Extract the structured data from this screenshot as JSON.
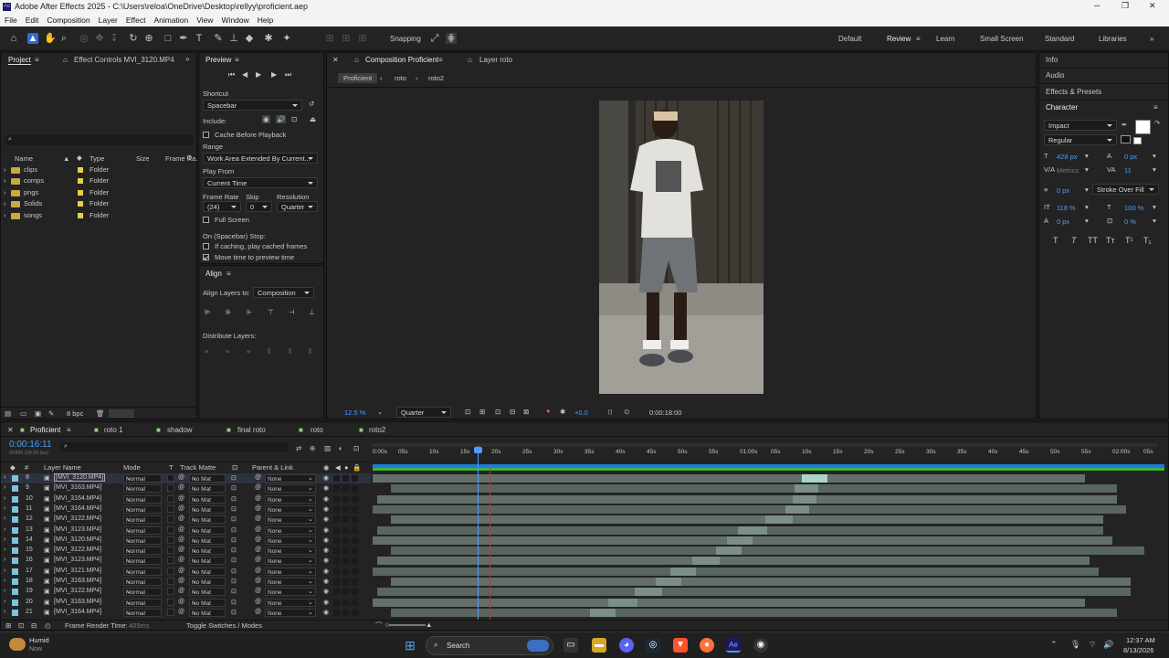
{
  "title": "Adobe After Effects 2025 - C:\\Users\\reloa\\OneDrive\\Desktop\\rellyy\\proficient.aep",
  "menu": [
    "File",
    "Edit",
    "Composition",
    "Layer",
    "Effect",
    "Animation",
    "View",
    "Window",
    "Help"
  ],
  "toolbar": {
    "snapping": "Snapping",
    "workspaces": [
      "Default",
      "Review",
      "Learn",
      "Small Screen",
      "Standard",
      "Libraries"
    ]
  },
  "project": {
    "tab": "Project",
    "effect_tab": "Effect Controls MVI_3120.MP4",
    "search_placeholder": "",
    "cols": [
      "Name",
      "Type",
      "Size",
      "Frame Ra..."
    ],
    "items": [
      {
        "name": "clips",
        "type": "Folder"
      },
      {
        "name": "comps",
        "type": "Folder"
      },
      {
        "name": "pngs",
        "type": "Folder"
      },
      {
        "name": "Solids",
        "type": "Folder"
      },
      {
        "name": "songs",
        "type": "Folder"
      }
    ],
    "bpc": "8 bpc"
  },
  "preview": {
    "tab": "Preview",
    "shortcut_label": "Shortcut",
    "shortcut": "Spacebar",
    "include": "Include:",
    "cache": "Cache Before Playback",
    "range_label": "Range",
    "range": "Work Area Extended By Current...",
    "playfrom_label": "Play From",
    "playfrom": "Current Time",
    "fr_label": "Frame Rate",
    "skip_label": "Skip",
    "res_label": "Resolution",
    "fr": "(24)",
    "skip": "0",
    "res": "Quarter",
    "fullscreen": "Full Screen",
    "stop_label": "On (Spacebar) Stop:",
    "stop1": "If caching, play cached frames",
    "stop2": "Move time to preview time"
  },
  "align": {
    "tab": "Align",
    "to_label": "Align Layers to:",
    "to": "Composition",
    "distribute": "Distribute Layers:"
  },
  "comp": {
    "tab": "Composition Proficient",
    "layer_tab": "Layer roto",
    "crumbs": [
      "Proficient",
      "roto",
      "roto2"
    ],
    "zoom": "12.5 %",
    "res": "Quarter",
    "exposure": "+0.0",
    "time": "0:00:18:00"
  },
  "right": {
    "info": "Info",
    "audio": "Audio",
    "effects": "Effects & Presets",
    "character": "Character",
    "font": "Impact",
    "style": "Regular",
    "size": "428 px",
    "leading": "0 px",
    "kerning": "Metrics",
    "tracking": "11",
    "stroke_w": "0 px",
    "stroke_type": "Stroke Over Fill",
    "vscale": "118 %",
    "hscale": "100 %",
    "baseline": "0 px",
    "tsume": "0 %"
  },
  "timeline": {
    "tabs": [
      "Proficient",
      "roto 1",
      "shadow",
      "final roto",
      "roto",
      "roto2"
    ],
    "timecode": "0:00:16:11",
    "frames": "00395 (24.00 fps)",
    "headers": {
      "num": "#",
      "name": "Layer Name",
      "mode": "Mode",
      "t": "T",
      "matte": "Track Matte",
      "parent": "Parent & Link"
    },
    "ruler": [
      "0:00s",
      "05s",
      "10s",
      "15s",
      "20s",
      "25s",
      "30s",
      "35s",
      "40s",
      "45s",
      "50s",
      "55s",
      "01:00s",
      "05s",
      "10s",
      "15s",
      "20s",
      "25s",
      "30s",
      "35s",
      "40s",
      "45s",
      "50s",
      "55s",
      "02:00s",
      "05s"
    ],
    "layers": [
      {
        "n": "8",
        "name": "[MVI_3120.MP4]",
        "mode": "Normal",
        "matte": "No Mat",
        "parent": "None"
      },
      {
        "n": "9",
        "name": "[MVI_3163.MP4]",
        "mode": "Normal",
        "matte": "No Mat",
        "parent": "None"
      },
      {
        "n": "10",
        "name": "[MVI_3164.MP4]",
        "mode": "Normal",
        "matte": "No Mat",
        "parent": "None"
      },
      {
        "n": "11",
        "name": "[MVI_3164.MP4]",
        "mode": "Normal",
        "matte": "No Mat",
        "parent": "None"
      },
      {
        "n": "12",
        "name": "[MVI_3122.MP4]",
        "mode": "Normal",
        "matte": "No Mat",
        "parent": "None"
      },
      {
        "n": "13",
        "name": "[MVI_3123.MP4]",
        "mode": "Normal",
        "matte": "No Mat",
        "parent": "None"
      },
      {
        "n": "14",
        "name": "[MVI_3120.MP4]",
        "mode": "Normal",
        "matte": "No Mat",
        "parent": "None"
      },
      {
        "n": "15",
        "name": "[MVI_3122.MP4]",
        "mode": "Normal",
        "matte": "No Mat",
        "parent": "None"
      },
      {
        "n": "16",
        "name": "[MVI_3123.MP4]",
        "mode": "Normal",
        "matte": "No Mat",
        "parent": "None"
      },
      {
        "n": "17",
        "name": "[MVI_3121.MP4]",
        "mode": "Normal",
        "matte": "No Mat",
        "parent": "None"
      },
      {
        "n": "18",
        "name": "[MVI_3163.MP4]",
        "mode": "Normal",
        "matte": "No Mat",
        "parent": "None"
      },
      {
        "n": "19",
        "name": "[MVI_3122.MP4]",
        "mode": "Normal",
        "matte": "No Mat",
        "parent": "None"
      },
      {
        "n": "20",
        "name": "[MVI_3163.MP4]",
        "mode": "Normal",
        "matte": "No Mat",
        "parent": "None"
      },
      {
        "n": "21",
        "name": "[MVI_3164.MP4]",
        "mode": "Normal",
        "matte": "No Mat",
        "parent": "None"
      }
    ],
    "render_time_label": "Frame Render Time:",
    "render_time": "409ms",
    "toggle": "Toggle Switches / Modes"
  },
  "taskbar": {
    "weather": "Humid",
    "weather_sub": "Now",
    "search": "Search",
    "time": "12:37 AM",
    "date": "8/13/2026"
  }
}
